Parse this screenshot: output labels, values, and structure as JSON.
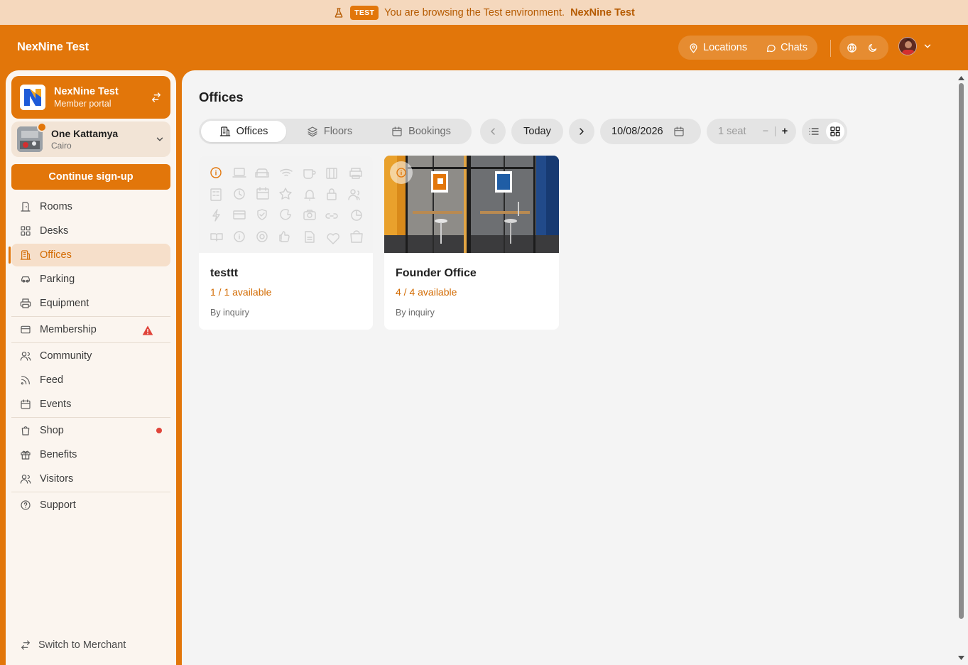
{
  "banner": {
    "badge": "TEST",
    "message": "You are browsing the Test environment.",
    "env_name": "NexNine Test"
  },
  "header": {
    "brand": "NexNine Test",
    "locations_label": "Locations",
    "chats_label": "Chats"
  },
  "sidebar": {
    "workspace": {
      "title": "NexNine Test",
      "subtitle": "Member portal"
    },
    "location": {
      "title": "One Kattamya",
      "subtitle": "Cairo"
    },
    "cta_label": "Continue sign-up",
    "items": [
      {
        "label": "Rooms",
        "icon": "door-icon"
      },
      {
        "label": "Desks",
        "icon": "grid-icon"
      },
      {
        "label": "Offices",
        "icon": "building-icon",
        "active": true
      },
      {
        "label": "Parking",
        "icon": "car-icon"
      },
      {
        "label": "Equipment",
        "icon": "printer-icon"
      },
      {
        "label": "Membership",
        "icon": "card-icon",
        "alert": "warning"
      },
      {
        "label": "Community",
        "icon": "users-icon"
      },
      {
        "label": "Feed",
        "icon": "rss-icon"
      },
      {
        "label": "Events",
        "icon": "calendar-icon"
      },
      {
        "label": "Shop",
        "icon": "bag-icon",
        "alert": "dot"
      },
      {
        "label": "Benefits",
        "icon": "gift-icon"
      },
      {
        "label": "Visitors",
        "icon": "user-icon"
      },
      {
        "label": "Support",
        "icon": "help-icon"
      }
    ],
    "switch_label": "Switch to Merchant"
  },
  "main": {
    "title": "Offices",
    "tabs": [
      {
        "label": "Offices",
        "active": true
      },
      {
        "label": "Floors"
      },
      {
        "label": "Bookings"
      }
    ],
    "today_label": "Today",
    "date_value": "10/08/2026",
    "seats_label": "1 seat",
    "minus_label": "−",
    "plus_label": "+",
    "view_mode": "grid",
    "cards": [
      {
        "name": "testtt",
        "availability": "1 / 1 available",
        "price": "By inquiry",
        "image": "placeholder-icons"
      },
      {
        "name": "Founder Office",
        "availability": "4 / 4 available",
        "price": "By inquiry",
        "image": "office-photo"
      }
    ]
  },
  "colors": {
    "accent": "#e2760a",
    "banner_bg": "#f5d8bd",
    "active_nav_bg": "#f6dfca",
    "warning": "#e0443a"
  }
}
